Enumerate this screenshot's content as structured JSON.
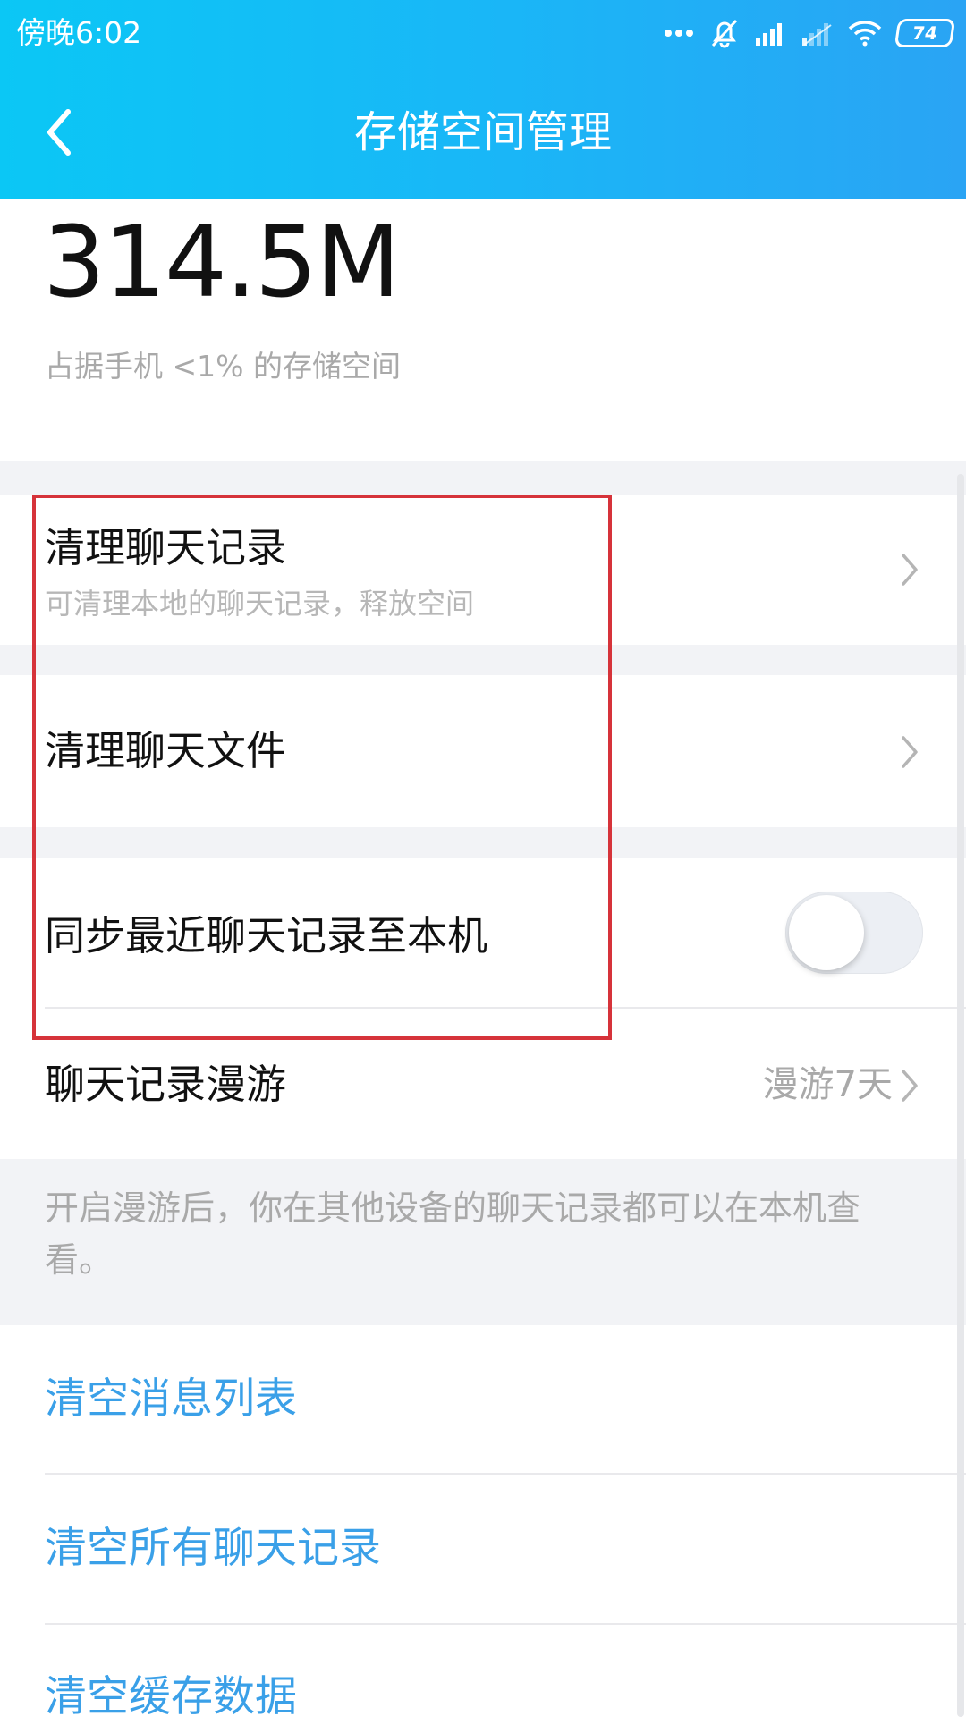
{
  "status_bar": {
    "time": "傍晚6:02",
    "battery": "74",
    "icons": [
      "more-dots-icon",
      "alarm-off-icon",
      "signal-icon",
      "signal-weak-icon",
      "wifi-icon",
      "battery-icon"
    ]
  },
  "header": {
    "title": "存储空间管理",
    "back_icon": "chevron-left-icon",
    "background_colors": [
      "#0bc7f5",
      "#2aa4f4"
    ]
  },
  "storage": {
    "size": "314.5M",
    "description": "占据手机 <1% 的存储空间"
  },
  "rows": {
    "clean_chat_history": {
      "title": "清理聊天记录",
      "subtitle": "可清理本地的聊天记录，释放空间",
      "icon": "chevron-right-icon"
    },
    "clean_chat_files": {
      "title": "清理聊天文件",
      "icon": "chevron-right-icon"
    },
    "sync_recent": {
      "title": "同步最近聊天记录至本机",
      "toggle_on": false
    },
    "roaming": {
      "title": "聊天记录漫游",
      "value": "漫游7天",
      "icon": "chevron-right-icon"
    }
  },
  "roaming_note": "开启漫游后，你在其他设备的聊天记录都可以在本机查看。",
  "actions": {
    "clear_message_list": "清空消息列表",
    "clear_all_history": "清空所有聊天记录",
    "clear_cache": "清空缓存数据"
  },
  "colors": {
    "action_text": "#3aa0e8",
    "highlight_border": "#d6333a",
    "separator": "#f2f3f6"
  }
}
